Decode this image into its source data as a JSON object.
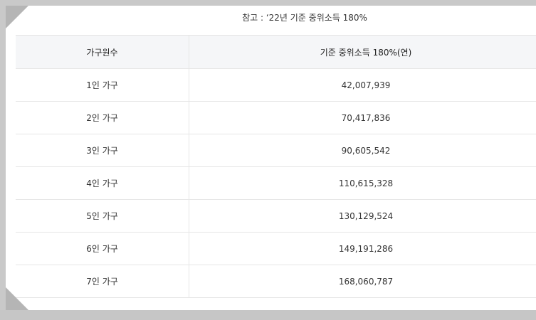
{
  "caption": "참고 : ‘22년 기준 중위소득 180%",
  "table": {
    "headers": [
      "가구원수",
      "기준 중위소득 180%(연)"
    ],
    "rows": [
      {
        "household": "1인 가구",
        "income": "42,007,939"
      },
      {
        "household": "2인 가구",
        "income": "70,417,836"
      },
      {
        "household": "3인 가구",
        "income": "90,605,542"
      },
      {
        "household": "4인 가구",
        "income": "110,615,328"
      },
      {
        "household": "5인 가구",
        "income": "130,129,524"
      },
      {
        "household": "6인 가구",
        "income": "149,191,286"
      },
      {
        "household": "7인 가구",
        "income": "168,060,787"
      }
    ]
  },
  "colors": {
    "header_bg": "#f5f6f8",
    "border": "#e6e6e6",
    "frame": "#c9c9c9"
  }
}
